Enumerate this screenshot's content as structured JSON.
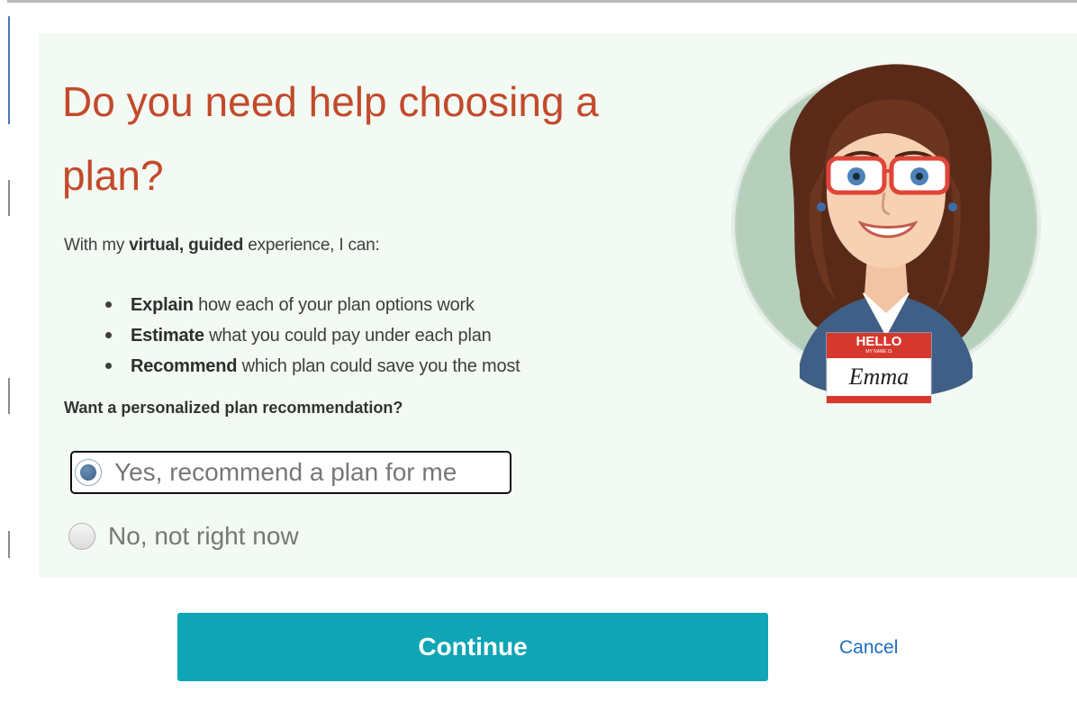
{
  "dialog": {
    "title": "Do you need help choosing a plan?",
    "intro": {
      "prefix": "With my ",
      "bold": "virtual, guided",
      "suffix": " experience, I can:"
    },
    "bullets": [
      {
        "bold": "Explain",
        "text": " how each of your plan options work"
      },
      {
        "bold": "Estimate",
        "text": " what you could pay under each plan"
      },
      {
        "bold": "Recommend",
        "text": " which plan could save you the most"
      }
    ],
    "question": "Want a personalized plan recommendation?",
    "options": [
      {
        "label": "Yes, recommend a plan for me",
        "selected": true
      },
      {
        "label": "No, not right now",
        "selected": false
      }
    ],
    "avatar": {
      "badge_hello": "HELLO",
      "badge_sub": "MY NAME IS",
      "badge_name": "Emma",
      "icon": "avatar-illustration"
    },
    "continue_label": "Continue",
    "cancel_label": "Cancel"
  },
  "colors": {
    "title": "#c24a2b",
    "panel_bg": "#f3f9f3",
    "button": "#10a5b5",
    "link": "#1b6ec2",
    "radio_selected": "#3b5f88"
  }
}
